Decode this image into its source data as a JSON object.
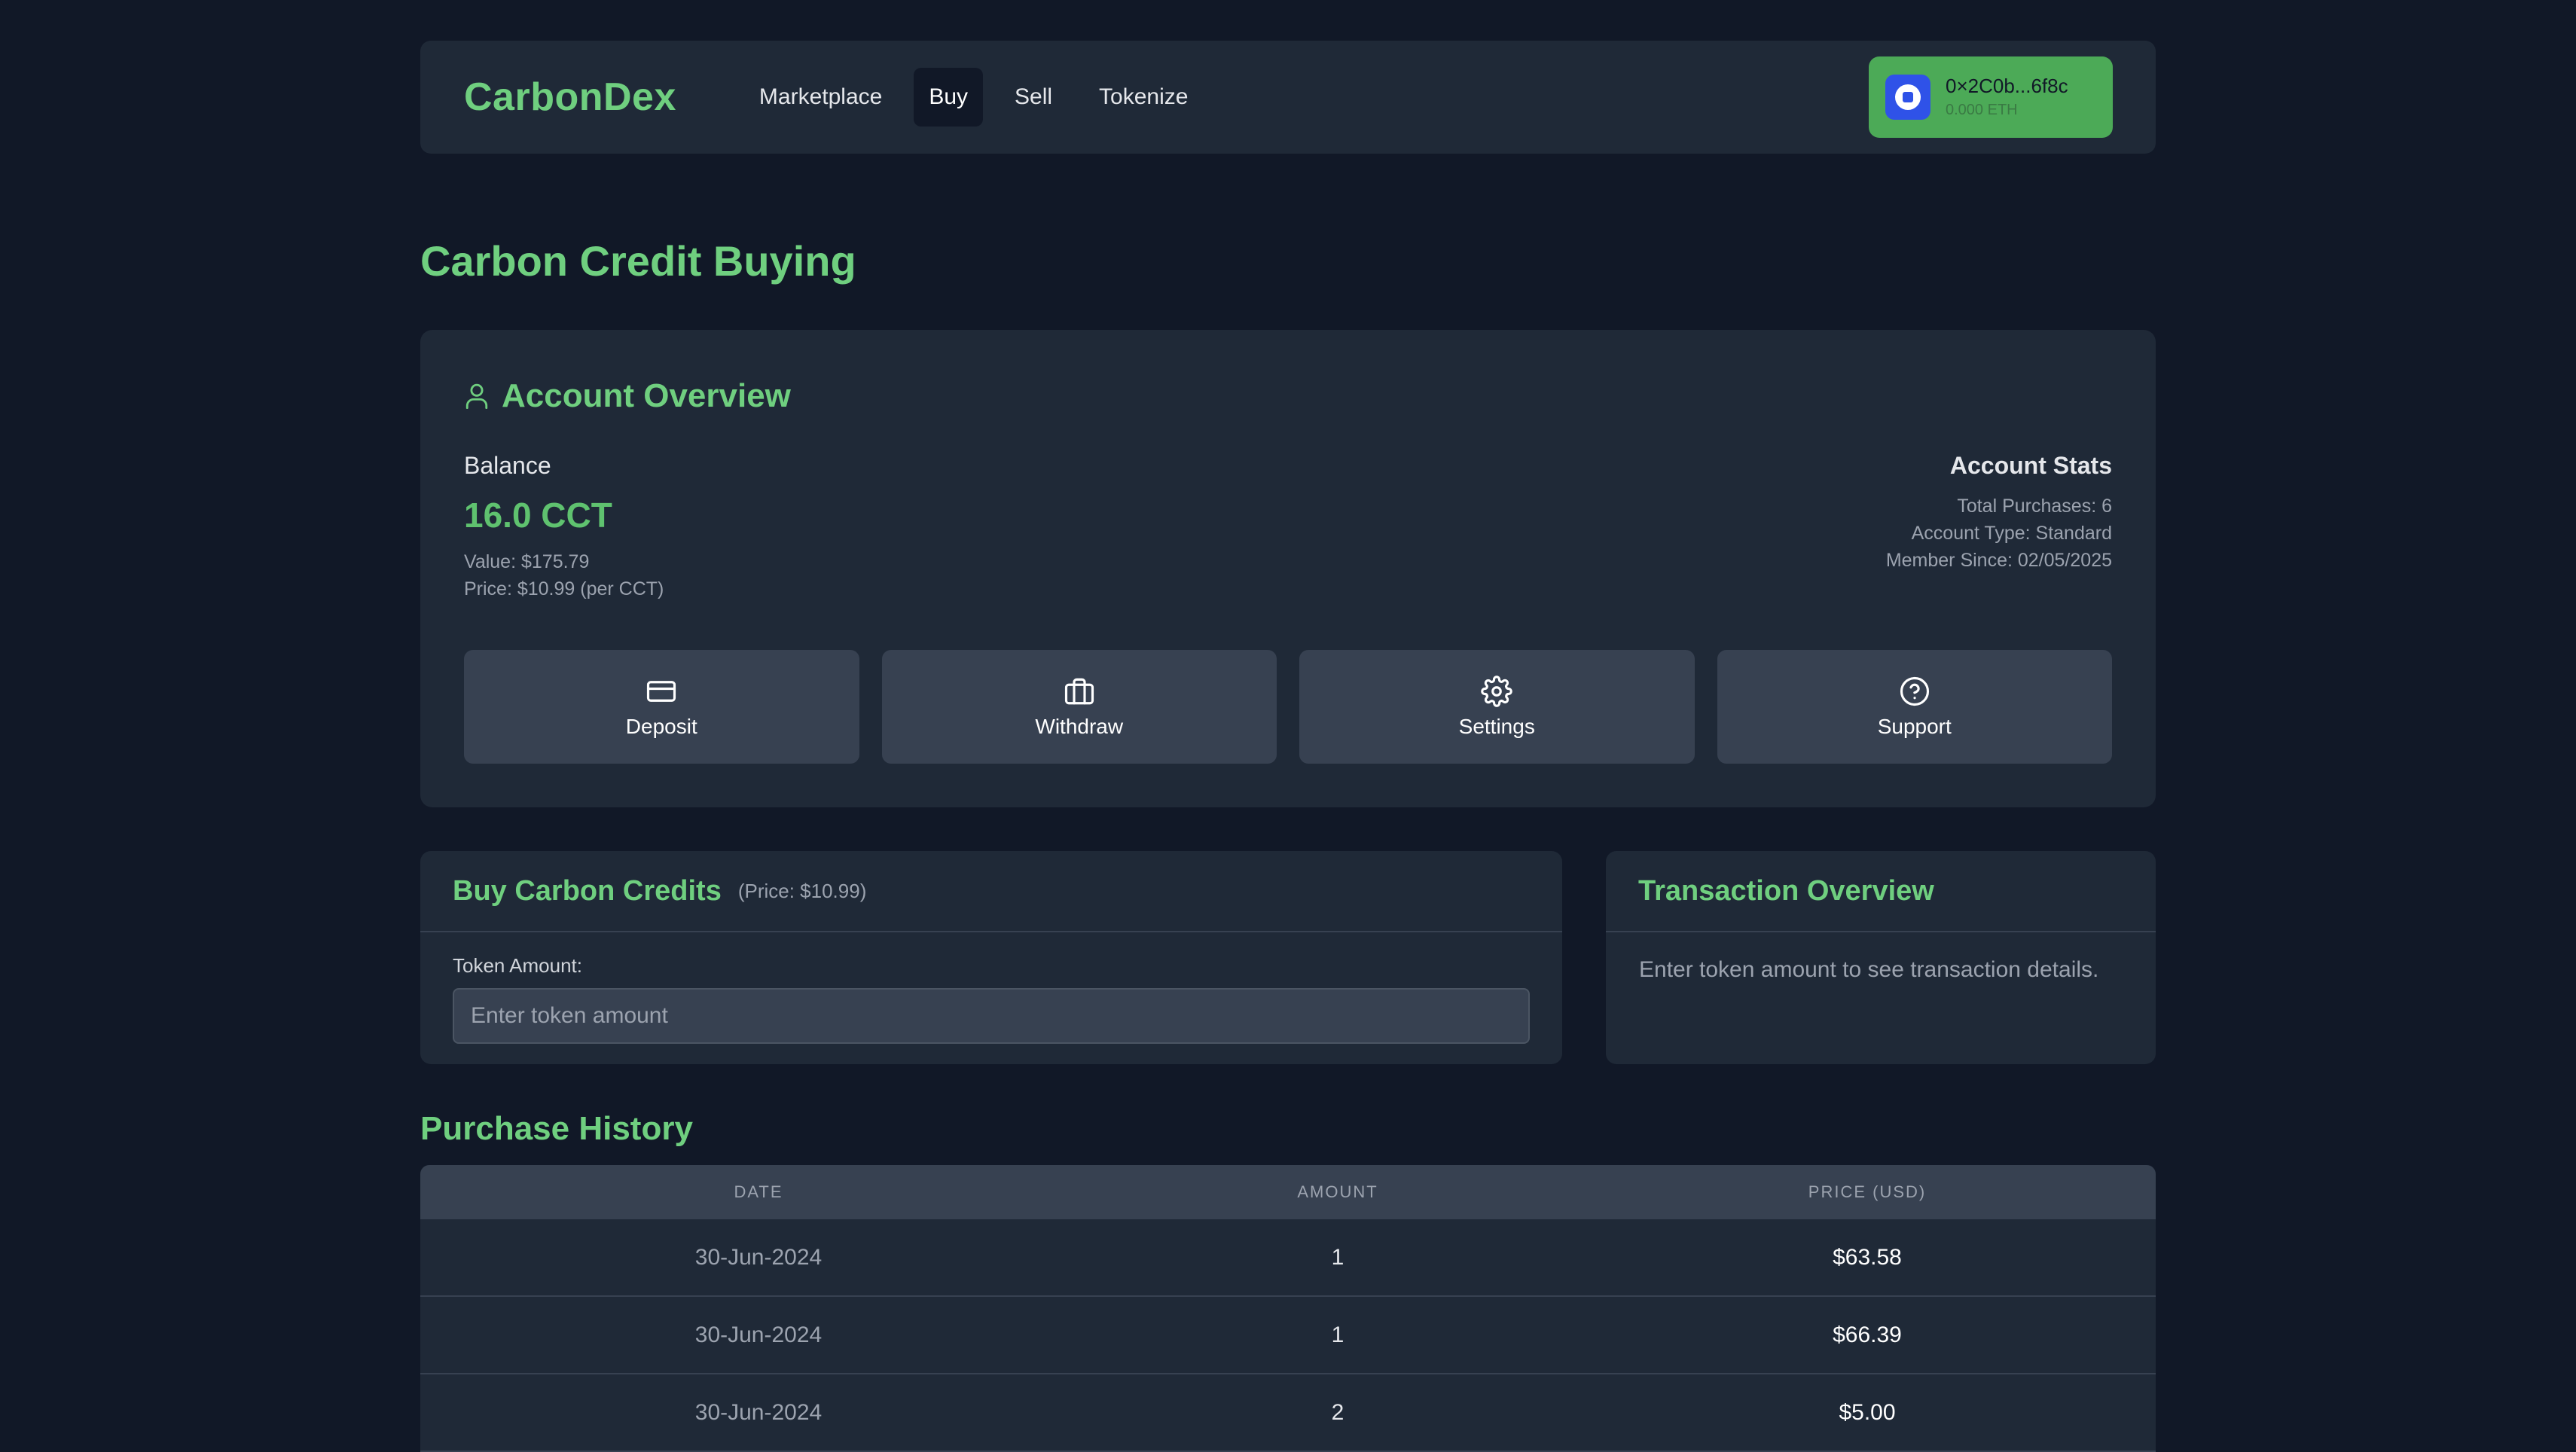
{
  "header": {
    "brand": "CarbonDex",
    "nav": [
      {
        "label": "Marketplace",
        "active": false
      },
      {
        "label": "Buy",
        "active": true
      },
      {
        "label": "Sell",
        "active": false
      },
      {
        "label": "Tokenize",
        "active": false
      }
    ],
    "wallet": {
      "address": "0×2C0b...6f8c",
      "balance": "0.000 ETH",
      "icon": "wallet-logo-icon"
    }
  },
  "page_title": "Carbon Credit Buying",
  "account": {
    "title": "Account Overview",
    "icon": "user-icon",
    "balance_label": "Balance",
    "balance_value": "16.0 CCT",
    "value_text": "Value: $175.79",
    "price_text": "Price: $10.99 (per CCT)",
    "stats_title": "Account Stats",
    "stats": [
      "Total Purchases: 6",
      "Account Type: Standard",
      "Member Since: 02/05/2025"
    ],
    "actions": [
      {
        "label": "Deposit",
        "icon": "credit-card-icon"
      },
      {
        "label": "Withdraw",
        "icon": "briefcase-icon"
      },
      {
        "label": "Settings",
        "icon": "gear-icon"
      },
      {
        "label": "Support",
        "icon": "help-circle-icon"
      }
    ]
  },
  "buy": {
    "title": "Buy Carbon Credits",
    "price_note": "(Price: $10.99)",
    "field_label": "Token Amount:",
    "placeholder": "Enter token amount",
    "value": ""
  },
  "transaction": {
    "title": "Transaction Overview",
    "message": "Enter token amount to see transaction details."
  },
  "history": {
    "title": "Purchase History",
    "columns": [
      "DATE",
      "AMOUNT",
      "PRICE (USD)"
    ],
    "rows": [
      {
        "date": "30-Jun-2024",
        "amount": "1",
        "price": "$63.58"
      },
      {
        "date": "30-Jun-2024",
        "amount": "1",
        "price": "$66.39"
      },
      {
        "date": "30-Jun-2024",
        "amount": "2",
        "price": "$5.00"
      }
    ]
  },
  "colors": {
    "background": "#111827",
    "card": "#1f2937",
    "accent_green": "#6fcf7f",
    "wallet_green": "#4caa57",
    "wallet_blue": "#2f52e8"
  }
}
